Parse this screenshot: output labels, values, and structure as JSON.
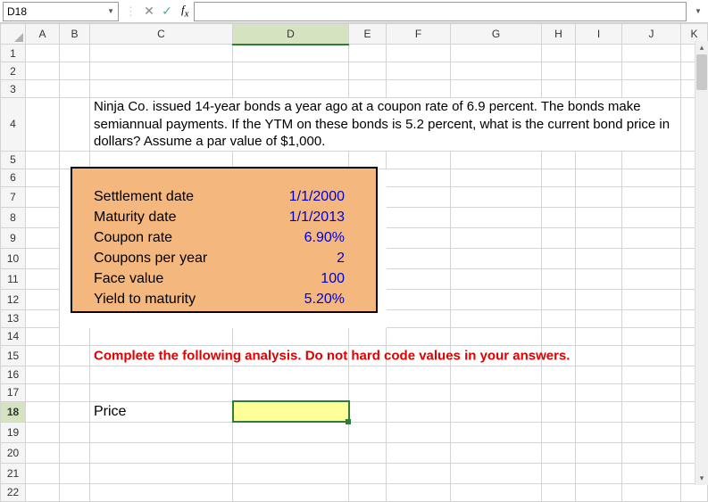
{
  "namebox": "D18",
  "formula": "",
  "columns": [
    "A",
    "B",
    "C",
    "D",
    "E",
    "F",
    "G",
    "H",
    "I",
    "J",
    "K"
  ],
  "rows": [
    "1",
    "2",
    "3",
    "4",
    "5",
    "6",
    "7",
    "8",
    "9",
    "10",
    "11",
    "12",
    "13",
    "14",
    "15",
    "16",
    "17",
    "18",
    "19",
    "20",
    "21",
    "22"
  ],
  "problem": "Ninja Co. issued 14-year bonds a year ago at a coupon rate of 6.9 percent. The bonds make semiannual payments. If the YTM on these bonds is 5.2 percent, what is the current bond price in dollars? Assume a par value of $1,000.",
  "labels": {
    "settlement": "Settlement date",
    "maturity": "Maturity date",
    "coupon": "Coupon rate",
    "freq": "Coupons per year",
    "face": "Face value",
    "ytm": "Yield to maturity",
    "price": "Price"
  },
  "values": {
    "settlement": "1/1/2000",
    "maturity": "1/1/2013",
    "coupon": "6.90%",
    "freq": "2",
    "face": "100",
    "ytm": "5.20%"
  },
  "instruction": "Complete the following analysis. Do not hard code values in your answers.",
  "active_cell": "D18",
  "selected_row": "18",
  "selected_col": "D"
}
